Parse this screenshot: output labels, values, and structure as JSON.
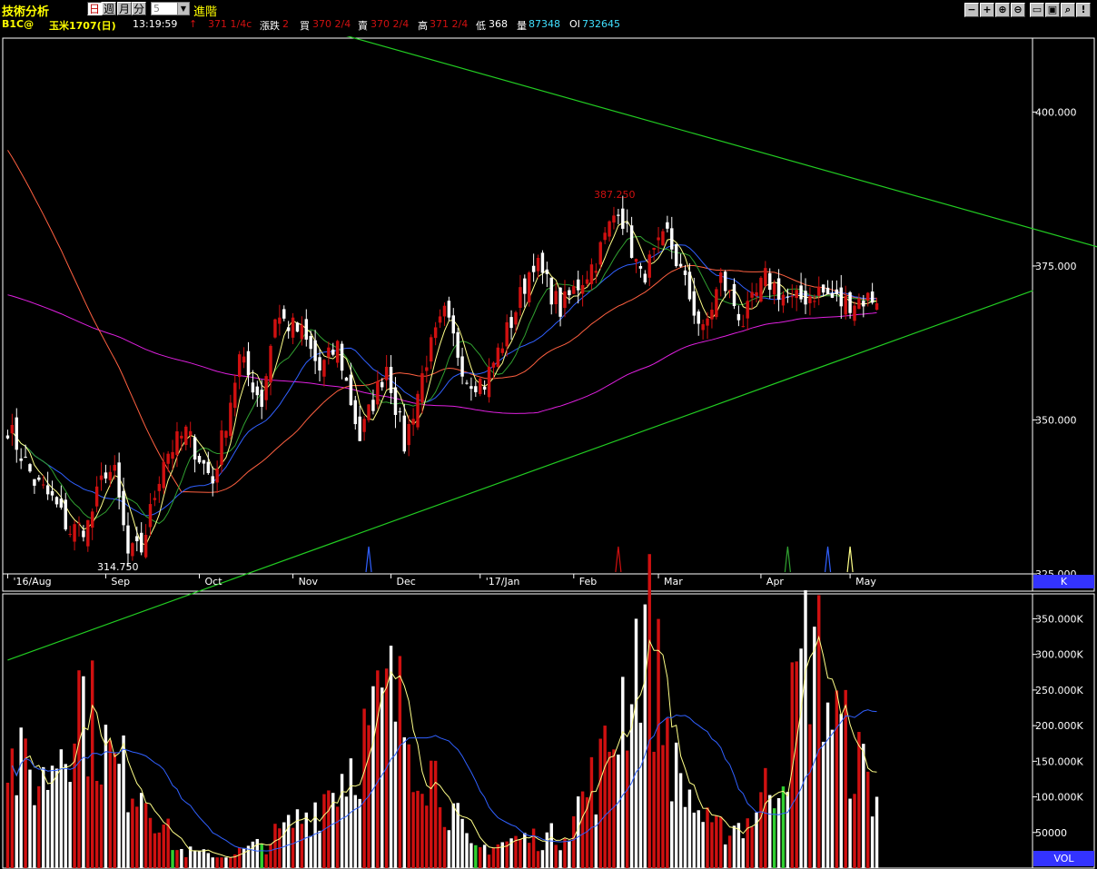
{
  "toolbar": {
    "title": "技術分析",
    "period_day": "日",
    "period_week": "週",
    "period_month": "月",
    "period_minute": "分",
    "minute_value": "5",
    "advanced": "進階",
    "icons": [
      "minus-icon",
      "plus-icon",
      "zoom-in-icon",
      "zoom-out-icon",
      "save-icon",
      "search-icon",
      "help-icon"
    ]
  },
  "info": {
    "symbol": "B1C@",
    "name": "玉米1707(日)",
    "time": "13:19:59",
    "arrow": "↑",
    "last": "371 1/4c",
    "change_label": "漲跌",
    "change": "2",
    "bid_label": "買",
    "bid": "370 2/4",
    "ask_label": "賣",
    "ask": "370 2/4",
    "high_label": "高",
    "high": "371 2/4",
    "low_label": "低",
    "low": "368",
    "vol_label": "量",
    "vol": "87348",
    "oi_label": "OI",
    "oi": "732645"
  },
  "colors": {
    "up": "#d01010",
    "down": "#ffffff",
    "trendline": "#22cc22",
    "ma_fast": "#ffff88",
    "ma_mid": "#3060ff",
    "ma_slow": "#ff6040",
    "ma_long": "#e020e0",
    "ma_green": "#30a030",
    "side_block": "#3333ff"
  },
  "chart_data": [
    {
      "type": "candlestick",
      "ylim": [
        325,
        412
      ],
      "yticks": [
        "400.000",
        "375.000",
        "350.000",
        "325.000"
      ],
      "ytick_values": [
        400,
        375,
        350,
        325
      ],
      "xticks": [
        "'16/Aug",
        "Sep",
        "Oct",
        "Nov",
        "Dec",
        "'17/Jan",
        "Feb",
        "Mar",
        "Apr",
        "May"
      ],
      "annotations": [
        {
          "label": "314.750"
        },
        {
          "label": "387.250"
        }
      ],
      "panel_label": "K",
      "n_bars": 196,
      "anchors": [
        {
          "i": 0,
          "v": 349
        },
        {
          "i": 6,
          "v": 340
        },
        {
          "i": 10,
          "v": 337
        },
        {
          "i": 14,
          "v": 332
        },
        {
          "i": 18,
          "v": 333
        },
        {
          "i": 22,
          "v": 342
        },
        {
          "i": 24,
          "v": 341
        },
        {
          "i": 27,
          "v": 328
        },
        {
          "i": 30,
          "v": 329
        },
        {
          "i": 35,
          "v": 344
        },
        {
          "i": 40,
          "v": 348
        },
        {
          "i": 46,
          "v": 340
        },
        {
          "i": 52,
          "v": 360
        },
        {
          "i": 57,
          "v": 353
        },
        {
          "i": 60,
          "v": 367
        },
        {
          "i": 66,
          "v": 364
        },
        {
          "i": 70,
          "v": 358
        },
        {
          "i": 74,
          "v": 362
        },
        {
          "i": 79,
          "v": 347
        },
        {
          "i": 85,
          "v": 359
        },
        {
          "i": 89,
          "v": 346
        },
        {
          "i": 94,
          "v": 360
        },
        {
          "i": 98,
          "v": 367
        },
        {
          "i": 103,
          "v": 357
        },
        {
          "i": 107,
          "v": 356
        },
        {
          "i": 113,
          "v": 366
        },
        {
          "i": 118,
          "v": 376
        },
        {
          "i": 124,
          "v": 368
        },
        {
          "i": 132,
          "v": 376
        },
        {
          "i": 137,
          "v": 385
        },
        {
          "i": 142,
          "v": 373
        },
        {
          "i": 148,
          "v": 380
        },
        {
          "i": 152,
          "v": 372
        },
        {
          "i": 156,
          "v": 364
        },
        {
          "i": 160,
          "v": 373
        },
        {
          "i": 165,
          "v": 366
        },
        {
          "i": 170,
          "v": 373
        },
        {
          "i": 176,
          "v": 369
        },
        {
          "i": 182,
          "v": 371
        },
        {
          "i": 187,
          "v": 369
        },
        {
          "i": 195,
          "v": 370
        }
      ],
      "trendlines": [
        {
          "name": "upper",
          "from": {
            "i": -50,
            "v": 438
          },
          "to": {
            "i": 245,
            "v": 378
          }
        },
        {
          "name": "lower",
          "from": {
            "i": 0,
            "v": 311
          },
          "to": {
            "i": 230,
            "v": 371
          }
        }
      ],
      "signals": [
        {
          "i": 81,
          "color": "#3060ff"
        },
        {
          "i": 137,
          "color": "#d01010"
        },
        {
          "i": 175,
          "color": "#30a030"
        },
        {
          "i": 184,
          "color": "#3060ff"
        },
        {
          "i": 189,
          "color": "#ffff88"
        }
      ]
    },
    {
      "type": "bar",
      "title": "",
      "ylim": [
        0,
        385000
      ],
      "yticks": [
        "350.000K",
        "300.000K",
        "250.000K",
        "200.000K",
        "150.000K",
        "100.000K",
        "50000"
      ],
      "ytick_values": [
        350000,
        300000,
        250000,
        200000,
        150000,
        100000,
        50000
      ],
      "panel_label": "VOL",
      "anchors": [
        {
          "i": 0,
          "v": 150000
        },
        {
          "i": 8,
          "v": 120000
        },
        {
          "i": 16,
          "v": 250000
        },
        {
          "i": 24,
          "v": 140000
        },
        {
          "i": 30,
          "v": 120000
        },
        {
          "i": 38,
          "v": 25000
        },
        {
          "i": 48,
          "v": 15000
        },
        {
          "i": 58,
          "v": 35000
        },
        {
          "i": 68,
          "v": 80000
        },
        {
          "i": 76,
          "v": 140000
        },
        {
          "i": 86,
          "v": 240000
        },
        {
          "i": 96,
          "v": 130000
        },
        {
          "i": 104,
          "v": 25000
        },
        {
          "i": 114,
          "v": 40000
        },
        {
          "i": 124,
          "v": 45000
        },
        {
          "i": 134,
          "v": 150000
        },
        {
          "i": 143,
          "v": 350000
        },
        {
          "i": 150,
          "v": 130000
        },
        {
          "i": 158,
          "v": 50000
        },
        {
          "i": 166,
          "v": 65000
        },
        {
          "i": 174,
          "v": 150000
        },
        {
          "i": 180,
          "v": 330000
        },
        {
          "i": 186,
          "v": 200000
        },
        {
          "i": 195,
          "v": 100000
        }
      ]
    }
  ]
}
